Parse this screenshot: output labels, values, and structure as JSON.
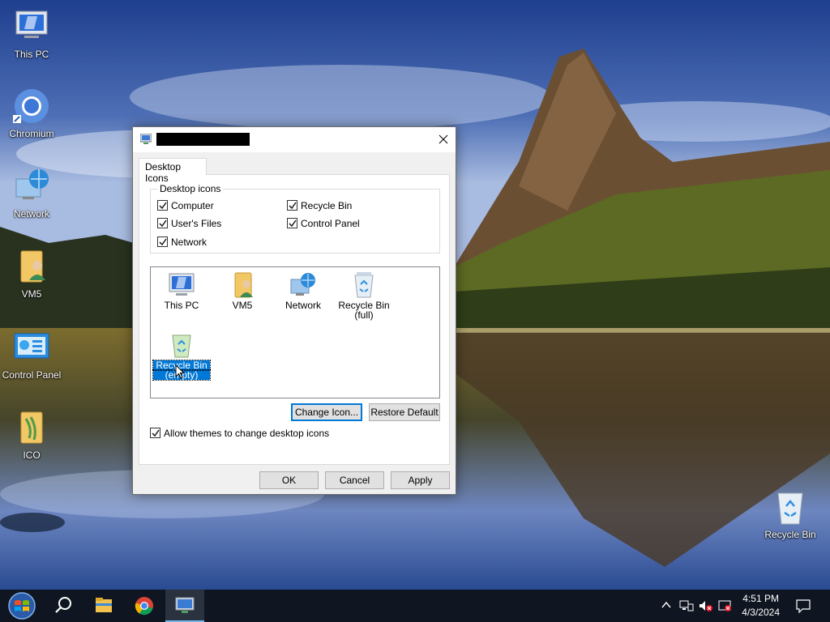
{
  "desktop": {
    "icons": [
      {
        "label": "This PC",
        "icon": "this-pc-icon"
      },
      {
        "label": "Chromium",
        "icon": "chromium-icon"
      },
      {
        "label": "Network",
        "icon": "network-icon"
      },
      {
        "label": "VM5",
        "icon": "user-folder-icon"
      },
      {
        "label": "Control Panel",
        "icon": "control-panel-icon"
      },
      {
        "label": "ICO",
        "icon": "folder-icon"
      },
      {
        "label": "Recycle Bin",
        "icon": "recycle-bin-icon"
      }
    ]
  },
  "dialog": {
    "tab_label": "Desktop Icons",
    "group_title": "Desktop icons",
    "checkboxes": [
      {
        "label": "Computer",
        "checked": true
      },
      {
        "label": "User's Files",
        "checked": true
      },
      {
        "label": "Network",
        "checked": true
      },
      {
        "label": "Recycle Bin",
        "checked": true
      },
      {
        "label": "Control Panel",
        "checked": true
      }
    ],
    "icon_list": [
      {
        "label": "This PC",
        "icon": "this-pc-icon"
      },
      {
        "label": "VM5",
        "icon": "user-folder-icon"
      },
      {
        "label": "Network",
        "icon": "network-icon"
      },
      {
        "label": "Recycle Bin\n(full)",
        "label_line1": "Recycle Bin",
        "label_line2": "(full)",
        "icon": "recycle-bin-full-icon"
      },
      {
        "label_line1": "Recycle Bin",
        "label_line2": "(empty)",
        "icon": "recycle-bin-empty-icon",
        "selected": true
      }
    ],
    "change_icon_label": "Change Icon...",
    "restore_default_label": "Restore Default",
    "allow_themes_label": "Allow themes to change desktop icons",
    "allow_themes_checked": true,
    "ok_label": "OK",
    "cancel_label": "Cancel",
    "apply_label": "Apply"
  },
  "taskbar": {
    "time": "4:51 PM",
    "date": "4/3/2024"
  },
  "colors": {
    "selection": "#0078d7",
    "taskbar": "#101621"
  }
}
